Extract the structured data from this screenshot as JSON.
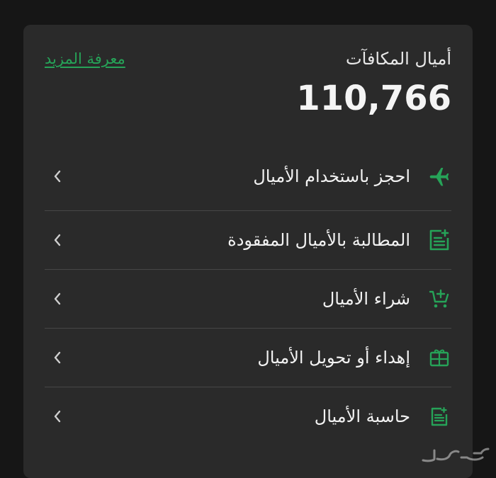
{
  "rewards": {
    "title": "أميال المكافآت",
    "miles": "110,766",
    "learn_more": "معرفة المزيد"
  },
  "colors": {
    "accent": "#26a358",
    "background": "#161616",
    "card": "#2a2a2a",
    "divider": "#474747"
  },
  "menu": [
    {
      "label": "احجز باستخدام الأميال",
      "icon": "airplane-icon"
    },
    {
      "label": "المطالبة بالأميال المفقودة",
      "icon": "document-plus-icon"
    },
    {
      "label": "شراء الأميال",
      "icon": "cart-plus-icon"
    },
    {
      "label": "إهداء أو تحويل الأميال",
      "icon": "gift-card-icon"
    },
    {
      "label": "حاسبة الأميال",
      "icon": "calculator-icon"
    }
  ],
  "watermark_icon": "haraj-logo-icon"
}
